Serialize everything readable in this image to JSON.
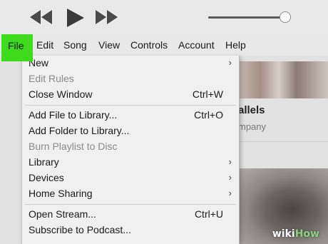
{
  "player": {
    "prev_icon": "rewind-icon",
    "play_icon": "play-icon",
    "next_icon": "fast-forward-icon",
    "volume_level": 0.95
  },
  "menubar": {
    "items": [
      {
        "label": "File"
      },
      {
        "label": "Edit"
      },
      {
        "label": "Song"
      },
      {
        "label": "View"
      },
      {
        "label": "Controls"
      },
      {
        "label": "Account"
      },
      {
        "label": "Help"
      }
    ],
    "highlight_color": "#3ddb1c"
  },
  "file_menu": {
    "items": [
      {
        "label": "New",
        "shortcut": "",
        "submenu": true,
        "enabled": true
      },
      {
        "label": "Edit Rules",
        "shortcut": "",
        "submenu": false,
        "enabled": false
      },
      {
        "label": "Close Window",
        "shortcut": "Ctrl+W",
        "submenu": false,
        "enabled": true
      },
      {
        "label": "Add File to Library...",
        "shortcut": "Ctrl+O",
        "submenu": false,
        "enabled": true
      },
      {
        "label": "Add Folder to Library...",
        "shortcut": "",
        "submenu": false,
        "enabled": true
      },
      {
        "label": "Burn Playlist to Disc",
        "shortcut": "",
        "submenu": false,
        "enabled": false
      },
      {
        "label": "Library",
        "shortcut": "",
        "submenu": true,
        "enabled": true
      },
      {
        "label": "Devices",
        "shortcut": "",
        "submenu": true,
        "enabled": true
      },
      {
        "label": "Home Sharing",
        "shortcut": "",
        "submenu": true,
        "enabled": true
      },
      {
        "label": "Open Stream...",
        "shortcut": "Ctrl+U",
        "submenu": false,
        "enabled": true
      },
      {
        "label": "Subscribe to Podcast...",
        "shortcut": "",
        "submenu": false,
        "enabled": true
      }
    ],
    "submenu_arrow": "›"
  },
  "background": {
    "album_title": "allels",
    "album_subtitle": "mpany"
  },
  "watermark": {
    "part1": "wiki",
    "part2": "How"
  }
}
